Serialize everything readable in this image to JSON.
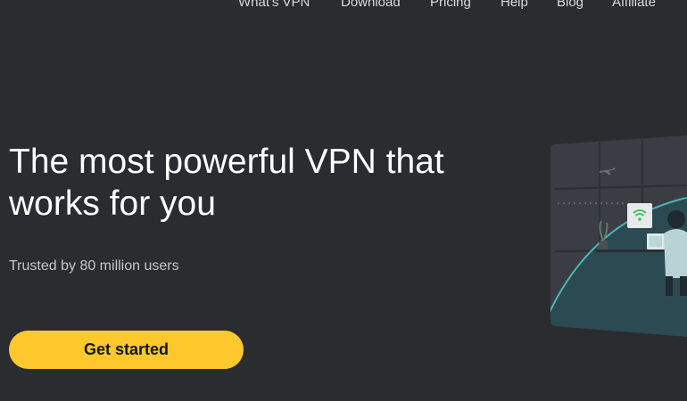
{
  "nav": {
    "items": [
      {
        "label": "What's VPN"
      },
      {
        "label": "Download"
      },
      {
        "label": "Pricing"
      },
      {
        "label": "Help"
      },
      {
        "label": "Blog"
      },
      {
        "label": "Affiliate"
      }
    ]
  },
  "hero": {
    "title": "The most powerful VPN that works for you",
    "subtitle": "Trusted by 80 million users",
    "cta_label": "Get started"
  },
  "illustration": {
    "icons": [
      "airplane-icon",
      "wifi-icon",
      "laptop-icon",
      "plant-icon",
      "person-icon"
    ]
  },
  "colors": {
    "background": "#2b2c30",
    "cta": "#ffc82c",
    "cta_text": "#141414",
    "accent_teal": "#4fb3b5",
    "wifi_green": "#3fc45a"
  }
}
